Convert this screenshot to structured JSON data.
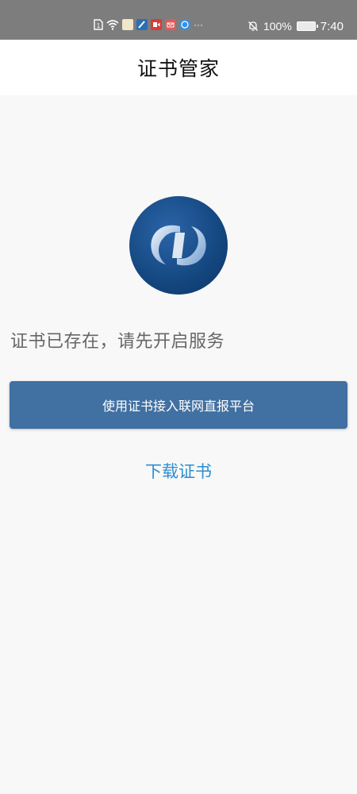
{
  "status_bar": {
    "battery": "100%",
    "time": "7:40",
    "overflow": "···",
    "colors": {
      "background": "#7d7d7d"
    },
    "icons": [
      "sim-icon",
      "wifi-icon",
      "app-notification-icon",
      "pen-icon",
      "video-icon",
      "mail-icon",
      "globe-icon"
    ]
  },
  "header": {
    "title": "证书管家"
  },
  "main": {
    "message": "证书已存在，请先开启服务",
    "primary_button": "使用证书接入联网直报平台",
    "download_link": "下载证书"
  },
  "colors": {
    "primary_button": "#4170a2",
    "link": "#2a8fd0",
    "page_background": "#f8f8f8"
  }
}
